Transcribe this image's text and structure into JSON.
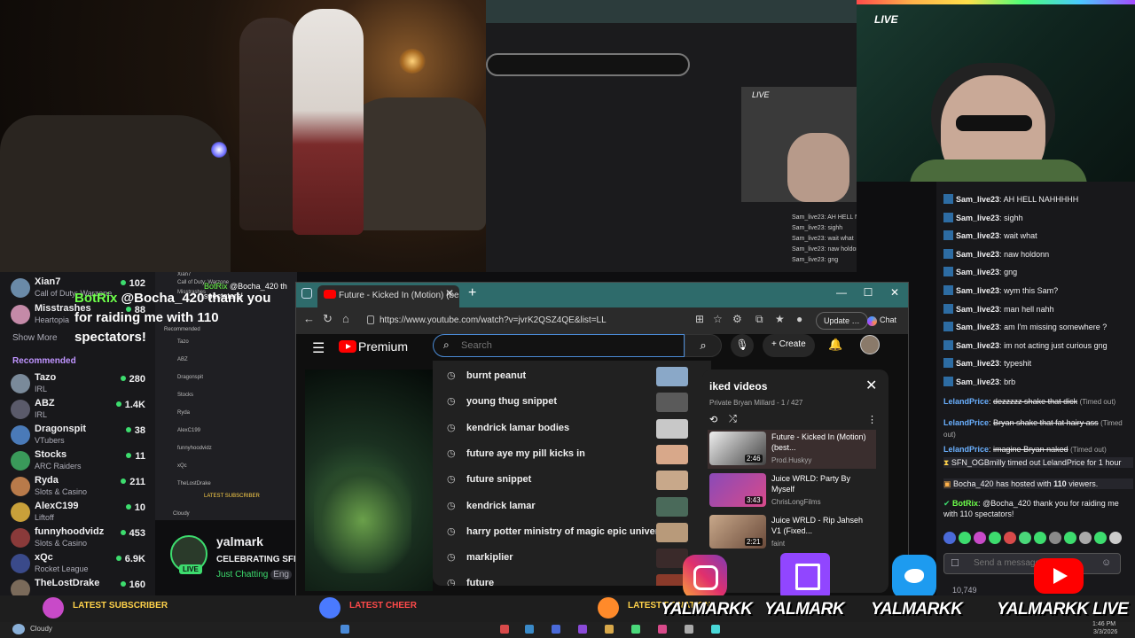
{
  "overlay": {
    "live_label": "LIVE",
    "mini_live_label": "LIVE",
    "raid_user": "BotRix",
    "raid_text": "@Bocha_420 thank you for raiding me with 110 spectators!",
    "mini_raid_user": "BotRix",
    "mini_raid_text": "@Bocha_420 th spectators!"
  },
  "mini_chat": [
    "Sam_live23: AH HELL NAHHHHH",
    "Sam_live23: sighh",
    "Sam_live23: wait what",
    "Sam_live23: naw holdonn",
    "Sam_live23: gng"
  ],
  "left_sidebar": {
    "followed": [
      {
        "name": "Xian7",
        "category": "Call of Duty: Warzone",
        "viewers": "102",
        "color": "#6a8aa8"
      },
      {
        "name": "Misstrashes",
        "category": "Heartopia",
        "viewers": "88",
        "color": "#c48aa8"
      }
    ],
    "show_more": "Show More",
    "recommended_label": "Recommended",
    "recommended": [
      {
        "name": "Tazo",
        "category": "IRL",
        "viewers": "280",
        "color": "#7a8a9a"
      },
      {
        "name": "ABZ",
        "category": "IRL",
        "viewers": "1.4K",
        "color": "#5a5a6a"
      },
      {
        "name": "Dragonspit",
        "category": "VTubers",
        "viewers": "38",
        "color": "#4a7ab8"
      },
      {
        "name": "Stocks",
        "category": "ARC Raiders",
        "viewers": "11",
        "color": "#3a9a5a"
      },
      {
        "name": "Ryda",
        "category": "Slots & Casino",
        "viewers": "211",
        "color": "#b87a4a"
      },
      {
        "name": "AlexC199",
        "category": "Liftoff",
        "viewers": "10",
        "color": "#c8a03a"
      },
      {
        "name": "funnyhoodvidz",
        "category": "Slots & Casino",
        "viewers": "453",
        "color": "#8a3a3a"
      },
      {
        "name": "xQc",
        "category": "Rocket League",
        "viewers": "6.9K",
        "color": "#3a4a8a"
      },
      {
        "name": "TheLostDrake",
        "category": "",
        "viewers": "160",
        "color": "#7a6a5a"
      }
    ]
  },
  "mini_left": {
    "r1": "Xian7",
    "r2": "Call of Duty: Warzone",
    "r3": "Misstrashes",
    "r4": "Recommended",
    "r5": "Tazo",
    "r6": "ABZ",
    "r7": "Dragonspit",
    "r8": "Stocks",
    "r9": "Ryda",
    "r10": "AlexC199",
    "r11": "funnyhoodvidz",
    "r12": "xQc",
    "r13": "TheLostDrake",
    "r14": "LATEST SUBSCRIBER",
    "r15": "Cloudy"
  },
  "streamer": {
    "name": "yalmark",
    "title": "CELEBRATING SFN",
    "category": "Just Chatting",
    "tag": "Eng",
    "live_badge": "LIVE"
  },
  "browser": {
    "tab_title": "Future - Kicked In (Motion) (best q",
    "url": "https://www.youtube.com/watch?v=jvrK2QSZ4QE&list=LL",
    "update_label": "Update",
    "chat_label": "Chat"
  },
  "youtube": {
    "brand": "Premium",
    "search_placeholder": "Search",
    "create_label": "Create",
    "suggestions": [
      "burnt peanut",
      "young thug snippet",
      "kendrick lamar bodies",
      "future aye my pill kicks in",
      "future snippet",
      "kendrick lamar",
      "harry potter ministry of magic epic universe",
      "markiplier",
      "future"
    ],
    "playlist": {
      "title": "iked videos",
      "meta": "Private Bryan Millard - 1 / 427",
      "items": [
        {
          "title": "Future - Kicked In (Motion) (best...",
          "channel": "Prod.Huskyy",
          "duration": "2:46"
        },
        {
          "title": "Juice WRLD: Party By Myself",
          "channel": "ChrisLongFilms",
          "duration": "3:43"
        },
        {
          "title": "Juice WRLD - Rip Jahseh V1 (Fixed...",
          "channel": "faint",
          "duration": "2:21"
        }
      ]
    }
  },
  "chat": {
    "messages": [
      {
        "user": "Sam_live23",
        "text": "AH HELL NAHHHHH"
      },
      {
        "user": "Sam_live23",
        "text": "sighh"
      },
      {
        "user": "Sam_live23",
        "text": "wait what"
      },
      {
        "user": "Sam_live23",
        "text": "naw holdonn"
      },
      {
        "user": "Sam_live23",
        "text": "gng"
      },
      {
        "user": "Sam_live23",
        "text": "wym this Sam?"
      },
      {
        "user": "Sam_live23",
        "text": "man hell nahh"
      },
      {
        "user": "Sam_live23",
        "text": "am I'm missing somewhere ?"
      },
      {
        "user": "Sam_live23",
        "text": "im not acting just curious gng"
      },
      {
        "user": "Sam_live23",
        "text": "typeshit"
      },
      {
        "user": "Sam_live23",
        "text": "brb"
      }
    ],
    "timed_out": [
      {
        "user": "LelandPrice",
        "text": "dezzzzz shake that dick",
        "tag": "(Timed out)"
      },
      {
        "user": "LelandPrice",
        "text": "Bryan shake that fat hairy ass",
        "tag": "(Timed out)"
      },
      {
        "user": "LelandPrice",
        "text": "imagine Bryan naked",
        "tag": "(Timed out)"
      }
    ],
    "notice_timeout": "SFN_OGBmilly timed out LelandPrice for 1 hour",
    "notice_host_user": "Bocha_420",
    "notice_host_text": "has hosted with",
    "notice_host_count": "110",
    "notice_host_suffix": "viewers.",
    "botrix_user": "BotRix",
    "botrix_text": "@Bocha_420 thank you for raiding me with 110 spectators!",
    "input_placeholder": "Send a message",
    "viewers": "10,749",
    "user_color": "#2d6ca3",
    "lp_color": "#6ab0ff"
  },
  "ticker": {
    "latest_subscriber": "LATEST SUBSCRIBER",
    "latest_donation": "LATEST DONATION",
    "latest_cheer": "LATEST CHEER",
    "handles": [
      "YALMARKK",
      "YALMARK",
      "YALMARKK",
      "YALMARKK LIVE"
    ]
  },
  "taskbar": {
    "weather": "Cloudy",
    "time": "1:46 PM",
    "date": "3/3/2026"
  }
}
